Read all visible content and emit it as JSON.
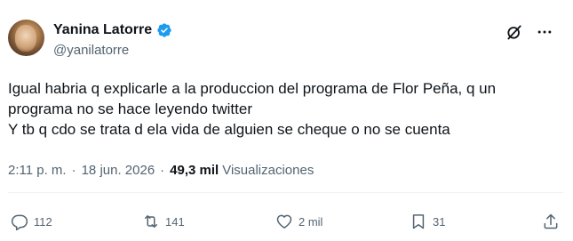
{
  "author": {
    "display_name": "Yanina Latorre",
    "handle": "@yanilatorre"
  },
  "tweet": {
    "lines": [
      "Igual habria q explicarle a la produccion del programa de Flor Peña, q un",
      "programa no se hace leyendo twitter",
      "Y tb q cdo se trata d ela vida de alguien se cheque o no se cuenta"
    ]
  },
  "meta": {
    "time": "2:11 p. m.",
    "separator": "·",
    "date": "18 jun. 2026",
    "views_count": "49,3 mil",
    "views_label": "Visualizaciones"
  },
  "actions": {
    "replies": "112",
    "reposts": "141",
    "likes": "2 mil",
    "bookmarks": "31"
  },
  "colors": {
    "verified": "#1d9bf0",
    "secondary_text": "#536471",
    "primary_text": "#0f1419"
  },
  "icons": [
    "verified-badge-icon",
    "grok-icon",
    "more-icon",
    "reply-icon",
    "retweet-icon",
    "like-icon",
    "bookmark-icon",
    "share-icon"
  ]
}
